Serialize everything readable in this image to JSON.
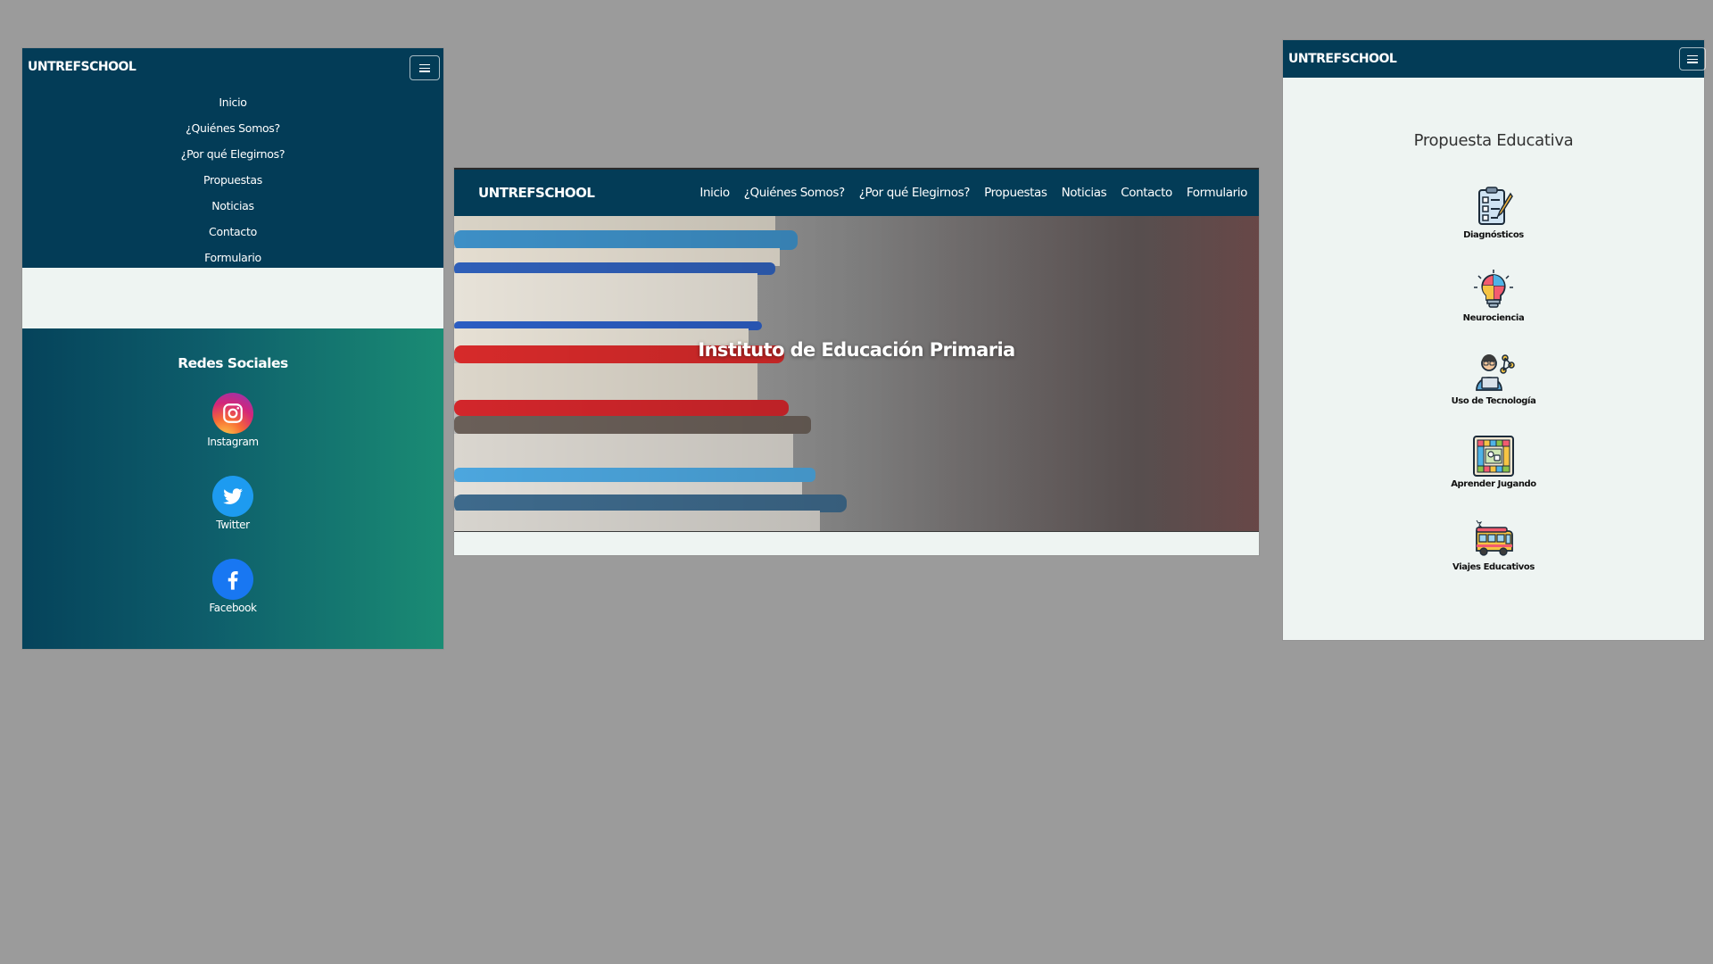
{
  "brand": "UNTREFSCHOOL",
  "nav_items": [
    "Inicio",
    "¿Quiénes Somos?",
    "¿Por qué Elegirnos?",
    "Propuestas",
    "Noticias",
    "Contacto",
    "Formulario"
  ],
  "colors": {
    "navbar": "#033c57",
    "page_bg": "#eef4f2",
    "canvas_bg": "#9b9b9b",
    "social_gradient": [
      "#05435b",
      "#1a8c74"
    ]
  },
  "social": {
    "title": "Redes Sociales",
    "items": [
      {
        "label": "Instagram",
        "icon": "instagram-icon"
      },
      {
        "label": "Twitter",
        "icon": "twitter-icon"
      },
      {
        "label": "Facebook",
        "icon": "facebook-icon"
      }
    ]
  },
  "hero": {
    "title": "Instituto de Educación Primaria",
    "image": "stack-of-books-photo"
  },
  "propuesta": {
    "title": "Propuesta Educativa",
    "items": [
      {
        "label": "Diagnósticos",
        "icon": "checklist-icon"
      },
      {
        "label": "Neurociencia",
        "icon": "brain-lightbulb-icon"
      },
      {
        "label": "Uso de Tecnología",
        "icon": "student-laptop-icon"
      },
      {
        "label": "Aprender Jugando",
        "icon": "board-game-icon"
      },
      {
        "label": "Viajes Educativos",
        "icon": "school-bus-icon"
      }
    ]
  }
}
